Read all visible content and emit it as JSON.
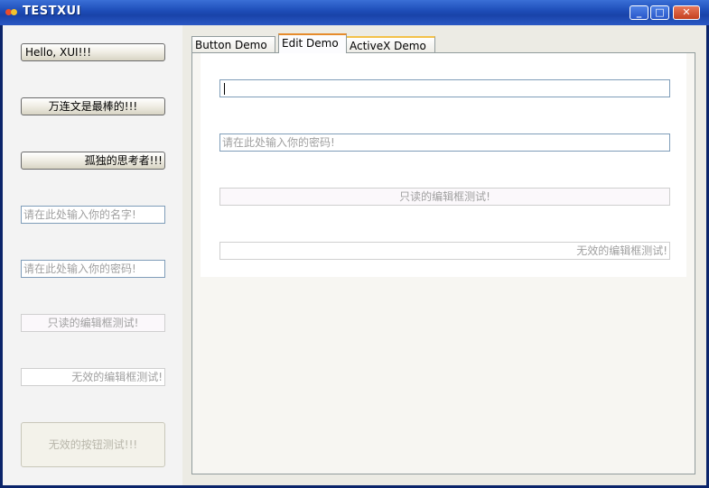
{
  "window": {
    "title": "TESTXUI",
    "controls": {
      "minimize": "_",
      "maximize": "□",
      "close": "✕"
    }
  },
  "left": {
    "buttons": [
      "Hello, XUI!!!",
      "万连文是最棒的!!!",
      "孤独的思考者!!!"
    ],
    "name_placeholder": "请在此处输入你的名字!",
    "password_placeholder": "请在此处输入你的密码!",
    "readonly_text": "只读的编辑框测试!",
    "disabled_text": "无效的编辑框测试!",
    "disabled_button": "无效的按钮测试!!!"
  },
  "tabs": [
    "Button Demo",
    "Edit Demo",
    "ActiveX Demo"
  ],
  "selected_tab": "Edit Demo",
  "edit_demo": {
    "text_value": "",
    "password_placeholder": "请在此处输入你的密码!",
    "readonly_text": "只读的编辑框测试!",
    "disabled_text": "无效的编辑框测试!"
  },
  "colors": {
    "title_bar": "#1f4fba",
    "edit_border": "#7f9db9",
    "tab_highlight": "#e68b2c"
  }
}
